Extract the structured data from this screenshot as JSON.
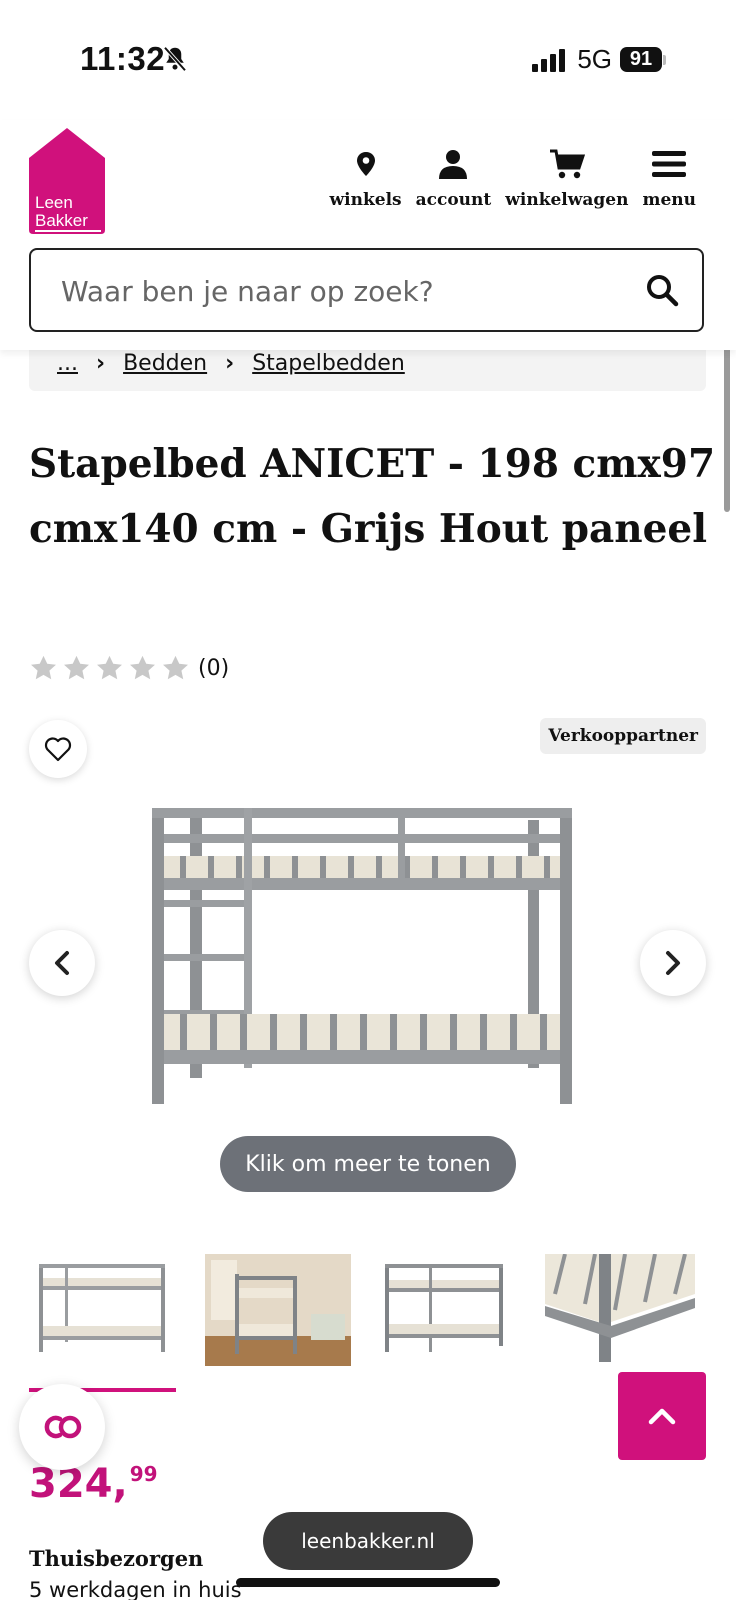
{
  "status_bar": {
    "time": "11:32",
    "network": "5G",
    "battery": "91"
  },
  "header": {
    "logo_line1": "Leen",
    "logo_line2": "Bakker",
    "brand_color": "#d0117c",
    "nav": [
      {
        "label": "winkels",
        "icon": "location-pin-icon"
      },
      {
        "label": "account",
        "icon": "user-icon"
      },
      {
        "label": "winkelwagen",
        "icon": "cart-icon"
      },
      {
        "label": "menu",
        "icon": "hamburger-icon"
      }
    ],
    "search_placeholder": "Waar ben je naar op zoek?"
  },
  "breadcrumb": {
    "items": [
      "...",
      "Bedden",
      "Stapelbedden"
    ]
  },
  "product": {
    "title": "Stapelbed ANICET - 198 cmx97 cmx140 cm - Grijs Hout paneel",
    "rating_value": 0,
    "rating_max": 5,
    "rating_count": "(0)",
    "partner_badge": "Verkooppartner",
    "more_button": "Klik om meer te tonen",
    "price_main": "324,",
    "price_cents": "99",
    "price_color": "#c2127a",
    "delivery_title": "Thuisbezorgen",
    "delivery_sub": "5 werkdagen in huis",
    "thumbnails": [
      "bunk-bed-front",
      "bunk-bed-room",
      "bunk-bed-angle",
      "bunk-bed-detail"
    ],
    "active_thumbnail": 0
  },
  "browser": {
    "url": "leenbakker.nl"
  }
}
